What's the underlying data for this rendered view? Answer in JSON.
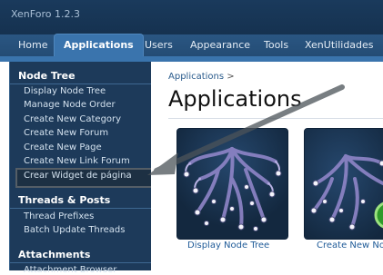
{
  "app": {
    "brand": "XenForo 1.2.3"
  },
  "tabs": [
    {
      "label": "Home"
    },
    {
      "label": "Applications"
    },
    {
      "label": "Users"
    },
    {
      "label": "Appearance"
    },
    {
      "label": "Tools"
    },
    {
      "label": "XenUtilidades"
    }
  ],
  "sidebar": {
    "node_tree": {
      "heading": "Node Tree",
      "items": [
        "Display Node Tree",
        "Manage Node Order",
        "Create New Category",
        "Create New Forum",
        "Create New Page",
        "Create New Link Forum",
        "Crear Widget de página"
      ]
    },
    "threads": {
      "heading": "Threads & Posts",
      "items": [
        "Thread Prefixes",
        "Batch Update Threads"
      ]
    },
    "attachments": {
      "heading": "Attachments",
      "items": [
        "Attachment Browser"
      ]
    }
  },
  "main": {
    "breadcrumb": "Applications",
    "breadcrumb_sep": ">",
    "title": "Applications",
    "tiles": [
      {
        "caption": "Display Node Tree",
        "icon": "node-tree-icon"
      },
      {
        "caption": "Create New Nod",
        "icon": "create-node-icon"
      }
    ]
  },
  "colors": {
    "header_bg": "#1a3a5c",
    "tab_active": "#3a74ad",
    "sidebar_bg": "#1d3a5a",
    "link": "#1f5b98"
  }
}
